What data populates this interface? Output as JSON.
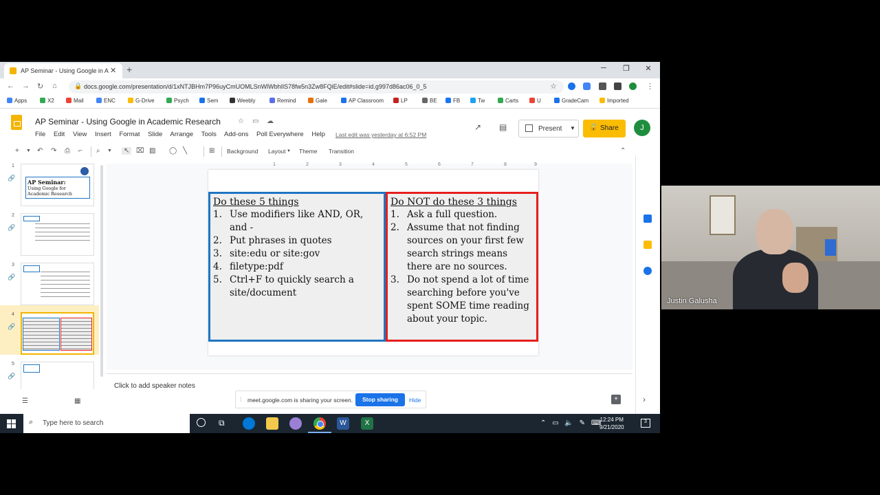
{
  "browser": {
    "tab_title": "AP Seminar - Using Google in Ac",
    "new_tab_label": "+",
    "url": "docs.google.com/presentation/d/1xNTJBHm7P96uyCmUOMLSnWlWbhIlS78fw5n3Zw8FQiE/edit#slide=id.g997d86ac06_0_5",
    "bookmarks": [
      "Apps",
      "X2",
      "Mail",
      "ENC",
      "G-Drive",
      "Psych",
      "Sem",
      "Weebly",
      "Remind",
      "Gale",
      "AP Classroom",
      "LP",
      "BE",
      "FB",
      "Tw",
      "Carts",
      "U",
      "GradeCam",
      "Imported"
    ]
  },
  "slides_app": {
    "doc_title": "AP Seminar - Using Google in Academic Research",
    "menus": [
      "File",
      "Edit",
      "View",
      "Insert",
      "Format",
      "Slide",
      "Arrange",
      "Tools",
      "Add-ons",
      "Poll Everywhere",
      "Help"
    ],
    "last_edit": "Last edit was yesterday at 6:52 PM",
    "present_label": "Present",
    "share_label": "Share",
    "avatar_initial": "J",
    "toolbar": {
      "background_label": "Background",
      "layout_label": "Layout",
      "theme_label": "Theme",
      "transition_label": "Transition"
    },
    "ruler_ticks": [
      "1",
      "2",
      "3",
      "4",
      "5",
      "6",
      "7",
      "8",
      "9"
    ],
    "speaker_notes_placeholder": "Click to add speaker notes"
  },
  "filmstrip": {
    "slide_numbers": [
      "1",
      "2",
      "3",
      "4",
      "5"
    ],
    "thumb1_title": "AP Seminar:",
    "thumb1_subtitle": "Using Google for Academic Research"
  },
  "slide": {
    "left_heading": "Do these 5 things",
    "left_items": [
      "Use modifiers like AND, OR, and -",
      "Put phrases in quotes",
      "site:edu or site:gov",
      "filetype:pdf",
      "Ctrl+F to quickly search a site/document"
    ],
    "right_heading": "Do NOT do these 3 things",
    "right_items": [
      "Ask a full question.",
      "Assume that not finding sources on your first few search strings means there are no sources.",
      "Do not spend a lot of time searching before you've spent SOME time reading about your topic."
    ]
  },
  "share_banner": {
    "message": "meet.google.com is sharing your screen.",
    "stop_label": "Stop sharing",
    "hide_label": "Hide"
  },
  "taskbar": {
    "search_placeholder": "Type here to search",
    "time": "12:24 PM",
    "date": "9/21/2020",
    "notification_count": "3"
  },
  "video": {
    "participant_name": "Justin Galusha"
  },
  "colors": {
    "left_box_border": "#1f75c2",
    "right_box_border": "#e61e1e",
    "share_button": "#fbbc04",
    "stop_button": "#1a73e8"
  }
}
